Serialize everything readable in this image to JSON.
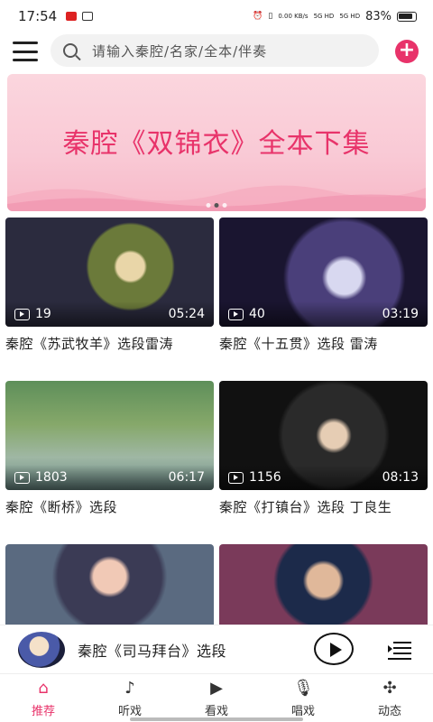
{
  "status": {
    "time": "17:54",
    "net_speed": "0.00 KB/s",
    "sig1": "5G HD",
    "sig2": "5G HD",
    "battery": "83%"
  },
  "search": {
    "placeholder": "请输入秦腔/名家/全本/伴奏",
    "icon": "search-icon"
  },
  "banner": {
    "title": "秦腔《双锦衣》全本下集",
    "slide_count": 3,
    "active_slide": 2
  },
  "videos": [
    {
      "views": "19",
      "duration": "05:24",
      "title": "秦腔《苏武牧羊》选段雷涛"
    },
    {
      "views": "40",
      "duration": "03:19",
      "title": "秦腔《十五贯》选段 雷涛"
    },
    {
      "views": "1803",
      "duration": "06:17",
      "title": "秦腔《断桥》选段"
    },
    {
      "views": "1156",
      "duration": "08:13",
      "title": "秦腔《打镇台》选段 丁良生"
    },
    {
      "views": "",
      "duration": "",
      "title": ""
    },
    {
      "views": "",
      "duration": "",
      "title": ""
    }
  ],
  "player": {
    "title": "秦腔《司马拜台》选段"
  },
  "tabs": [
    {
      "label": "推荐",
      "icon": "home-icon"
    },
    {
      "label": "听戏",
      "icon": "music-disc-icon"
    },
    {
      "label": "看戏",
      "icon": "video-icon"
    },
    {
      "label": "唱戏",
      "icon": "microphone-icon"
    },
    {
      "label": "动态",
      "icon": "pinwheel-icon"
    }
  ],
  "colors": {
    "accent": "#e8336a",
    "banner_bg": "#f9c9d5"
  }
}
